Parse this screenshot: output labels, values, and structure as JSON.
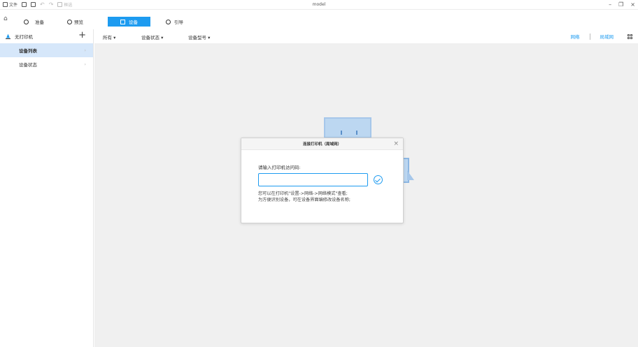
{
  "window": {
    "title": "model",
    "menu": [
      {
        "icon": "file-icon",
        "label": "文件"
      },
      {
        "icon": "save-icon",
        "label": ""
      },
      {
        "icon": "save-as-icon",
        "label": ""
      },
      {
        "icon": "undo-icon",
        "label": ""
      },
      {
        "icon": "redo-icon",
        "label": ""
      },
      {
        "icon": "frame-icon",
        "label": "框选"
      }
    ],
    "controls": {
      "minimize": "–",
      "restore": "❐",
      "close": "×"
    }
  },
  "tabs": [
    {
      "icon": "home-icon",
      "label": "⌂"
    },
    {
      "icon": "prepare-icon",
      "label": "准备"
    },
    {
      "icon": "preview-icon",
      "label": "预览"
    },
    {
      "icon": "device-icon",
      "label": "设备",
      "active": true
    },
    {
      "icon": "guide-icon",
      "label": "引导"
    }
  ],
  "sidebar": {
    "printer_label": "无打印机",
    "add_symbol": "+",
    "items": [
      {
        "label": "设备列表",
        "selected": true
      },
      {
        "label": "设备状态",
        "selected": false
      }
    ],
    "chevron": "›"
  },
  "filters": {
    "all": "所有 ▾",
    "status": "设备状态 ▾",
    "model": "设备型号 ▾"
  },
  "network": {
    "lan": "网络",
    "wan": "局域网"
  },
  "dialog": {
    "title": "连接打印机（局域网）",
    "close": "×",
    "prompt": "请输入打印机访问码:",
    "input_value": "",
    "hint1": "您可以在打印机\"设置->网络->网络模式\"查看;",
    "hint2": "为方便识别设备，可在设备界面编修改设备名称;"
  },
  "colors": {
    "accent": "#1d9bf0",
    "selected_bg": "#d6e7fa",
    "main_bg": "#f0f0f0"
  }
}
